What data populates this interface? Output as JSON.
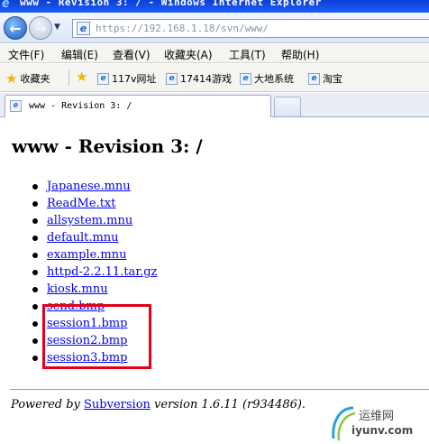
{
  "window": {
    "title": "www - Revision 3: / - Windows Internet Explorer"
  },
  "address_bar": {
    "url": "https://192.168.1.18/svn/www/"
  },
  "menu": {
    "items": [
      "文件(F)",
      "编辑(E)",
      "查看(V)",
      "收藏夹(A)",
      "工具(T)",
      "帮助(H)"
    ]
  },
  "favorites_bar": {
    "favorites_label": "收藏夹",
    "links": [
      "117v网址",
      "17414游戏",
      "大地系统",
      "淘宝"
    ]
  },
  "tabs": [
    {
      "label": "www - Revision 3: /",
      "active": true
    }
  ],
  "page": {
    "heading": "www - Revision 3: /",
    "files": [
      "Japanese.mnu",
      "ReadMe.txt",
      "allsystem.mnu",
      "default.mnu",
      "example.mnu",
      "httpd-2.2.11.tar.gz",
      "kiosk.mnu",
      "send.bmp",
      "session1.bmp",
      "session2.bmp",
      "session3.bmp"
    ],
    "footer": {
      "prefix": "Powered by ",
      "link": "Subversion",
      "suffix": " version 1.6.11 (r934486)."
    }
  },
  "annotation": {
    "highlight_color": "#e0001b"
  },
  "watermark": {
    "cn": "运维网",
    "domain": "iyunv.com"
  }
}
